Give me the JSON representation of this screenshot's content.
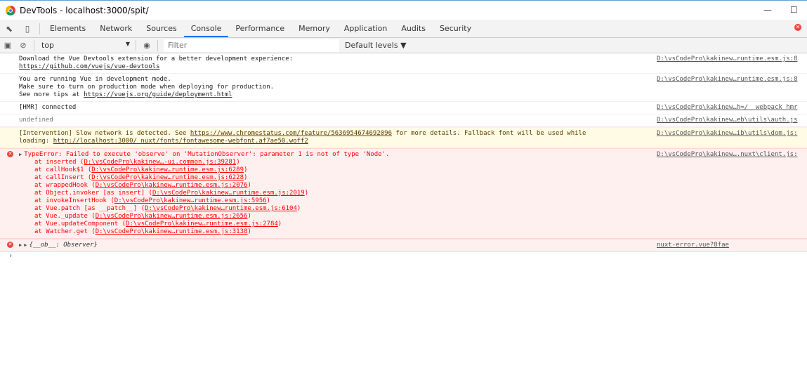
{
  "window": {
    "title": "DevTools - localhost:3000/spit/",
    "minimize": "—",
    "maximize": "☐"
  },
  "tabs": [
    {
      "label": "Elements"
    },
    {
      "label": "Network"
    },
    {
      "label": "Sources"
    },
    {
      "label": "Console"
    },
    {
      "label": "Performance"
    },
    {
      "label": "Memory"
    },
    {
      "label": "Application"
    },
    {
      "label": "Audits"
    },
    {
      "label": "Security"
    }
  ],
  "toolbar": {
    "context": "top",
    "filter_placeholder": "Filter",
    "levels": "Default levels ▼"
  },
  "messages": {
    "m1": {
      "l1": "Download the Vue Devtools extension for a better development experience:",
      "link": "https://github.com/vuejs/vue-devtools",
      "src": "D:\\vsCodePro\\kakinew…runtime.esm.js:8"
    },
    "m2": {
      "l1": "You are running Vue in development mode.",
      "l2": "Make sure to turn on production mode when deploying for production.",
      "l3": "See more tips at ",
      "link": "https://vuejs.org/guide/deployment.html",
      "src": "D:\\vsCodePro\\kakinew…runtime.esm.js:8"
    },
    "m3": {
      "l1": "[HMR] connected",
      "src": "D:\\vsCodePro\\kakinew…h=/__webpack_hmr"
    },
    "m4": {
      "l1": "undefined",
      "src": "D:\\vsCodePro\\kakinew…eb\\utils\\auth.js"
    },
    "m5": {
      "l1a": "[Intervention] Slow network is detected. See ",
      "link1": "https://www.chromestatus.com/feature/5636954674692096",
      "l1b": " for more details. Fallback font will be used while",
      "l2a": "loading: ",
      "link2": "http://localhost:3000/_nuxt/fonts/fontawesome-webfont.af7ae50.woff2",
      "src": "D:\\vsCodePro\\kakinew…ib\\utils\\dom.js:"
    },
    "m6": {
      "l1": "TypeError: Failed to execute 'observe' on 'MutationObserver': parameter 1 is not of type 'Node'.",
      "src": "D:\\vsCodePro\\kakinew….nuxt\\client.js:",
      "stack": [
        {
          "pre": "at inserted (",
          "link": "D:\\vsCodePro\\kakinew…-ui.common.js:39281",
          "post": ")"
        },
        {
          "pre": "at callHook$1 (",
          "link": "D:\\vsCodePro\\kakinew…runtime.esm.js:6289",
          "post": ")"
        },
        {
          "pre": "at callInsert (",
          "link": "D:\\vsCodePro\\kakinew…runtime.esm.js:6228",
          "post": ")"
        },
        {
          "pre": "at wrappedHook (",
          "link": "D:\\vsCodePro\\kakinew…runtime.esm.js:2076",
          "post": ")"
        },
        {
          "pre": "at Object.invoker [as insert] (",
          "link": "D:\\vsCodePro\\kakinew…runtime.esm.js:2019",
          "post": ")"
        },
        {
          "pre": "at invokeInsertHook (",
          "link": "D:\\vsCodePro\\kakinew…runtime.esm.js:5956",
          "post": ")"
        },
        {
          "pre": "at Vue.patch [as __patch__] (",
          "link": "D:\\vsCodePro\\kakinew…runtime.esm.js:6104",
          "post": ")"
        },
        {
          "pre": "at Vue._update (",
          "link": "D:\\vsCodePro\\kakinew…runtime.esm.js:2656",
          "post": ")"
        },
        {
          "pre": "at Vue.updateComponent (",
          "link": "D:\\vsCodePro\\kakinew…runtime.esm.js:2784",
          "post": ")"
        },
        {
          "pre": "at Watcher.get (",
          "link": "D:\\vsCodePro\\kakinew…runtime.esm.js:3138",
          "post": ")"
        }
      ]
    },
    "m7": {
      "l1": "{__ob__: Observer}",
      "src": "nuxt-error.vue?8fae"
    }
  },
  "prompt": "›",
  "colors": {
    "accent": "#1a73e8",
    "error_bg": "#fff0f0",
    "warning_bg": "#fffbe5",
    "error_text": "#ff0000"
  }
}
